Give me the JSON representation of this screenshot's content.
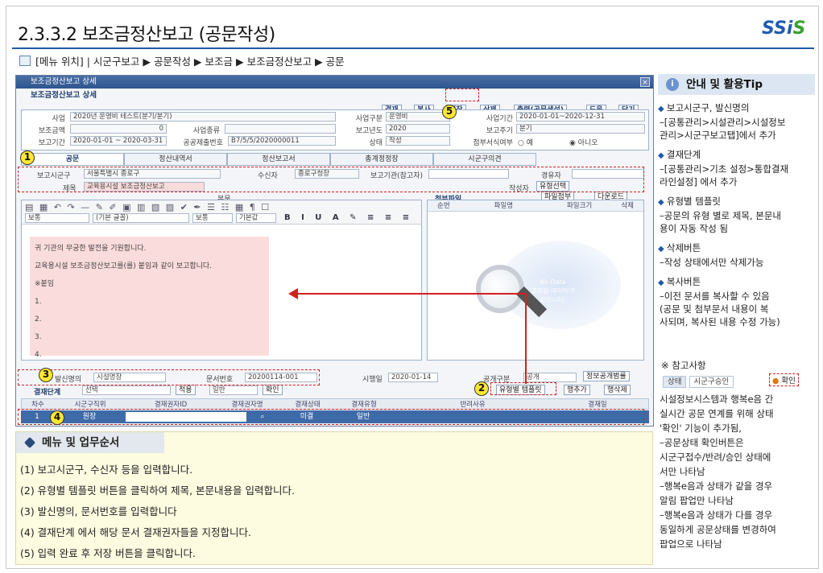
{
  "header": {
    "title": "2.3.3.2 보조금정산보고 (공문작성)",
    "logo_main": "SSi",
    "logo_accent": "S",
    "location_label": "[메뉴 위치] | 시군구보고 ▶ 공문작성 ▶ 보조금 ▶ 보조금정산보고 ▶ 공문"
  },
  "window": {
    "title": "보조금정산보고 상세",
    "subtitle": "보조금정산보고 상세",
    "close": "×",
    "toolbar": {
      "approve": "결재",
      "copy": "복사",
      "save": "저장",
      "delete": "삭제",
      "print": "출력(공문생성)",
      "help": "도움",
      "close": "닫기"
    },
    "form": {
      "biz_label": "사업",
      "biz_value": "2020년 운영비 테스트(분기/분기)",
      "biz_type_label": "사업구분",
      "biz_type_value": "운영비",
      "biz_period_label": "사업기간",
      "biz_period_value": "2020-01-01~2020-12-31",
      "amount_label": "보조금액",
      "amount_value": "0",
      "biz_kind_label": "사업종류",
      "report_year_label": "보고년도",
      "report_year_value": "2020",
      "report_cycle_label": "보고주기",
      "report_cycle_value": "분기",
      "report_period_label": "보고기간",
      "report_period_value": "2020-01-01 ~ 2020-03-31",
      "doc_no_label": "공공제출번호",
      "doc_no_value": "B7/5/5/2020000011",
      "status_label": "상태",
      "status_value": "작성",
      "attach_label": "첨부서식여부",
      "radio_yes": "예",
      "radio_no": "아니오"
    },
    "tabs": [
      "공문",
      "정산내역서",
      "정산보고서",
      "총계정정장",
      "시군구의견"
    ],
    "row1": {
      "report_gu_label": "보고시군구",
      "report_gu_value": "서울특별시 종로구",
      "recipient_label": "수신자",
      "recipient_value": "종로구청장",
      "report_org_label": "보고기관(참고자)",
      "cc_label": "경유자"
    },
    "row2": {
      "title_label": "제목",
      "title_value": "교육용시설 보조금정산보고",
      "author_label": "작성자",
      "author_btn": "유형선택"
    },
    "body_label": "본문",
    "editor": {
      "style_select": "보통",
      "font_select": "(기본 글꼴)",
      "size_select": "보통",
      "size2_select": "기본값",
      "lines": [
        "귀 기관의 무궁한 발전을 기원합니다.",
        "교육용시설 보조금정산보고를(를) 붙임과 같이 보고합니다.",
        "※붙임",
        "1.",
        "2.",
        "3.",
        "4."
      ]
    },
    "attach": {
      "title": "첨부파일",
      "attach_btn": "파일첨부",
      "download_btn": "다운로드",
      "columns": [
        "순번",
        "파일명",
        "파일크기",
        "삭제"
      ],
      "no_data_1": "No Data",
      "no_data_2": "조회된 데이터가",
      "no_data_3": "없습니다."
    },
    "row3": {
      "sender_label": "발신명의",
      "sender_value": "시설명장",
      "doc_no_label": "문서번호",
      "doc_no_value": "20200114-001",
      "enforce_label": "시행일",
      "enforce_value": "2020-01-14",
      "public_label": "공개구분",
      "public_value": "공개",
      "public_btn": "정보공개범률"
    },
    "approval_bar": {
      "stage_label": "결재단계",
      "stage_value": "선택",
      "apply_btn": "적용",
      "type_value": "일반",
      "confirm_btn": "확인",
      "template_btn": "유형별 템플릿",
      "row_add": "행추가",
      "row_del": "행삭제"
    },
    "approval_table": {
      "columns": [
        "차수",
        "시군구직위",
        "결재권자ID",
        "결재권자명",
        "결재상태",
        "결재유형",
        "반려사유",
        "결재일"
      ],
      "rows": [
        [
          "1",
          "원장",
          "",
          "",
          "미결",
          "일반",
          "",
          ""
        ]
      ]
    }
  },
  "steps": {
    "title": "메뉴 및 업무순서",
    "items": [
      "(1) 보고시군구, 수신자 등을 입력합니다.",
      "(2) 유형별 템플릿 버튼을 클릭하여 제목, 본문내용을 입력합니다.",
      "(3) 발신명의, 문서번호를 입력합니다",
      "(4) 결재단계 에서 해당 문서 결재권자들을 지정합니다.",
      "(5) 입력 완료 후 저장 버튼을 클릭합니다."
    ]
  },
  "side": {
    "title": "안내 및 활용Tip",
    "items": [
      {
        "head": "보고시군구, 발신명의",
        "lines": [
          "–[공통관리>시설관리>시설정보",
          "  관리>시군구보고탭]에서 추가"
        ]
      },
      {
        "head": "결재단계",
        "lines": [
          "–[공통관리>기초 설정>통합결재",
          "  라인설정] 에서 추가"
        ]
      },
      {
        "head": "유형별 템플릿",
        "lines": [
          "–공문의 유형 별로 제목, 본문내",
          "  용이 자동 작성 됨"
        ]
      },
      {
        "head": "삭제버튼",
        "lines": [
          "–작성 상태에서만 삭제가능"
        ]
      },
      {
        "head": "복사버튼",
        "lines": [
          "–이전 문서를 복사할 수 있음",
          "  (공문 및 첨부문서 내용이 복",
          "  사되며, 복사된 내용 수정 가능)"
        ]
      }
    ],
    "ref_title": "※ 참고사항",
    "ref_tab1": "상태",
    "ref_tab2": "시군구승인",
    "ref_btn": "확인",
    "ref_lines": [
      "시설정보시스템과 행복e음 간",
      "실시간 공문 연계를 위해 상태",
      "'확인' 기능이 추가됨,",
      "–공문상태 확인버튼은",
      "  시군구접수/반려/승인 상태에",
      "  서만 나타남",
      "–행복e음과 상태가 같을 경우",
      "  알림 팝업만 나타남",
      "–행복e음과 상태가 다를 경우",
      "  동일하게 공문상태를 변경하여",
      "  팝업으로 나타남"
    ]
  },
  "markers": [
    "1",
    "2",
    "3",
    "4",
    "5"
  ],
  "colors": {
    "accent": "#1e5aa8",
    "highlight": "#d42020",
    "marker": "#ffe733"
  }
}
